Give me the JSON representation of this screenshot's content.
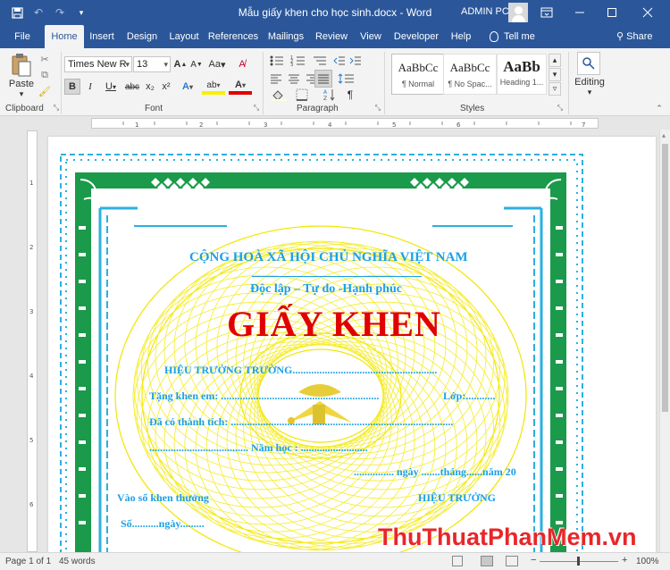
{
  "window": {
    "title": "Mẫu giấy khen cho học sinh.docx  -  Word",
    "user": "ADMIN PC"
  },
  "tabs": [
    "File",
    "Home",
    "Insert",
    "Design",
    "Layout",
    "References",
    "Mailings",
    "Review",
    "View",
    "Developer",
    "Help"
  ],
  "active_tab": "Home",
  "tell_me": "Tell me",
  "share": "Share",
  "ribbon": {
    "clipboard": {
      "paste": "Paste",
      "label": "Clipboard"
    },
    "font": {
      "name": "Times New R",
      "size": "13",
      "label": "Font",
      "grow": "A",
      "shrink": "A",
      "case": "Aa",
      "bold": "B",
      "italic": "I",
      "underline": "U",
      "strike": "abc",
      "sub": "x₂",
      "sup": "x²",
      "effects": "A",
      "highlight": "ab",
      "color": "A"
    },
    "paragraph": {
      "label": "Paragraph"
    },
    "styles": {
      "label": "Styles",
      "items": [
        {
          "sample": "AaBbCc",
          "name": "¶ Normal"
        },
        {
          "sample": "AaBbCc",
          "name": "¶ No Spac..."
        },
        {
          "sample": "AaBb",
          "name": "Heading 1..."
        }
      ]
    },
    "editing": {
      "label": "Editing"
    }
  },
  "certificate": {
    "nation": "CỘNG HOÀ XÃ HỘI CHỦ NGHĨA VIỆT NAM",
    "motto": "Độc lập – Tự do -Hạnh phúc",
    "title": "GIẤY KHEN",
    "principal_line": "HIỆU TRƯỞNG TRƯỜNG......................................................",
    "award_line": "Tặng khen em: ...........................................................",
    "class_label": "Lớp:...........",
    "achievement_line": "Đã có thành tích: ...................................................................................",
    "year_line": "..................................... Năm học : .........................",
    "date_line": "............... ngày .......tháng......năm 20",
    "register_label": "Vào sổ khen thưởng",
    "principal_sign": "HIỆU TRƯỞNG",
    "number_line": "Số..........ngày........."
  },
  "status": {
    "page": "Page 1 of 1",
    "words": "45 words",
    "zoom": "100%"
  },
  "watermark": "ThuThuatPhanMem.vn",
  "colors": {
    "accent": "#2b579a",
    "border_green": "#1a9a4a",
    "border_cyan": "#2ab0e0",
    "seal_yellow": "#f2e600",
    "title_red": "#e00000",
    "text_blue": "#1aa0e6"
  }
}
